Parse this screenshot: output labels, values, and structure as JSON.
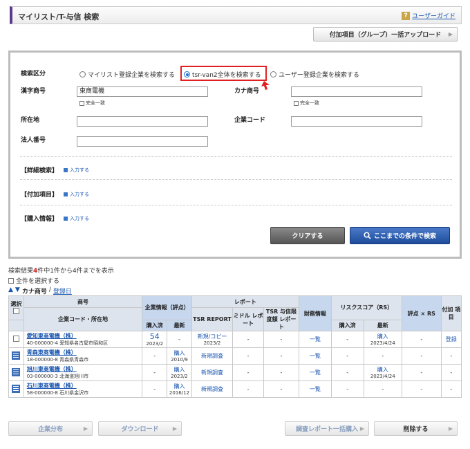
{
  "header": {
    "title": "マイリスト/T-与信 検索",
    "guide_label": "ユーザーガイド",
    "guide_icon": "?"
  },
  "upload_button": "付加項目（グループ）一括アップロード",
  "search": {
    "category_label": "検索区分",
    "radio_options": [
      "マイリスト登録企業を検索する",
      "tsr-van2全体を検索する",
      "ユーザー登録企業を検索する"
    ],
    "selected_index": 1,
    "kanji_label": "漢字商号",
    "kanji_value": "東商電機",
    "kana_label": "カナ商号",
    "kana_value": "",
    "exact_match": "完全一致",
    "address_label": "所在地",
    "company_code_label": "企業コード",
    "corp_number_label": "法人番号",
    "detail_label": "【詳細検索】",
    "addon_label": "【付加項目】",
    "purchase_label": "【購入情報】",
    "input_link": "入力する",
    "clear_button": "クリアする",
    "search_button": "ここまでの条件で検索"
  },
  "results": {
    "summary_pre": "検索結果",
    "summary_count": "4",
    "summary_post": "件中1件から4件までを表示",
    "select_all": "全件を選択する",
    "sort_kana": "カナ商号",
    "sort_sep": "/",
    "sort_date": "登録日"
  },
  "table": {
    "headers": {
      "select": "選択",
      "name": "商号",
      "code_addr": "企業コード・所在地",
      "company_info": "企業情報（評点）",
      "report": "レポート",
      "purchased": "購入済",
      "latest": "最新",
      "tsr_report": "TSR REPORT",
      "middle_report": "ミドル レポート",
      "tsr_limit": "TSR 与信限度額 レポート",
      "finance": "財務情報",
      "risk_score": "リスクスコア（RS）",
      "score_rs": "評点 × RS",
      "addon": "付加 項目"
    },
    "rows": [
      {
        "name": "愛知東商電機（株）",
        "code_addr": "40-000000-4 愛知県名古屋市昭和区",
        "ci_purchased": "54",
        "ci_purchased_date": "2023/2",
        "ci_latest": "-",
        "tsr": "新規/コピー",
        "tsr_date": "2023/2",
        "middle": "-",
        "limit": "-",
        "finance": "一覧",
        "rs_purchased": "-",
        "rs_latest": "購入",
        "rs_latest_date": "2023/4/24",
        "score_rs": "-",
        "addon": "登録"
      },
      {
        "name": "青森東商電機（株）",
        "code_addr": "18-000000-8 青森県青森市",
        "ci_purchased": "-",
        "ci_purchased_date": "",
        "ci_latest": "購入",
        "ci_latest_date": "2010/9",
        "tsr": "新規調査",
        "tsr_date": "",
        "middle": "-",
        "limit": "-",
        "finance": "一覧",
        "rs_purchased": "-",
        "rs_latest": "-",
        "rs_latest_date": "",
        "score_rs": "-",
        "addon": "-"
      },
      {
        "name": "旭川東商電機（株）",
        "code_addr": "03-000000-3 北海道旭川市",
        "ci_purchased": "-",
        "ci_purchased_date": "",
        "ci_latest": "購入",
        "ci_latest_date": "2023/2",
        "tsr": "新規調査",
        "tsr_date": "",
        "middle": "-",
        "limit": "-",
        "finance": "一覧",
        "rs_purchased": "-",
        "rs_latest": "購入",
        "rs_latest_date": "2023/4/24",
        "score_rs": "-",
        "addon": "-"
      },
      {
        "name": "石川東商電機（株）",
        "code_addr": "58-000000-8 石川県金沢市",
        "ci_purchased": "-",
        "ci_purchased_date": "",
        "ci_latest": "購入",
        "ci_latest_date": "2016/12",
        "tsr": "新規調査",
        "tsr_date": "",
        "middle": "-",
        "limit": "-",
        "finance": "一覧",
        "rs_purchased": "-",
        "rs_latest": "-",
        "rs_latest_date": "",
        "score_rs": "-",
        "addon": "-"
      }
    ]
  },
  "footer": {
    "company_dist": "企業分布",
    "download": "ダウンロード",
    "bulk_report": "調査レポート一括購入",
    "delete": "削除する"
  }
}
